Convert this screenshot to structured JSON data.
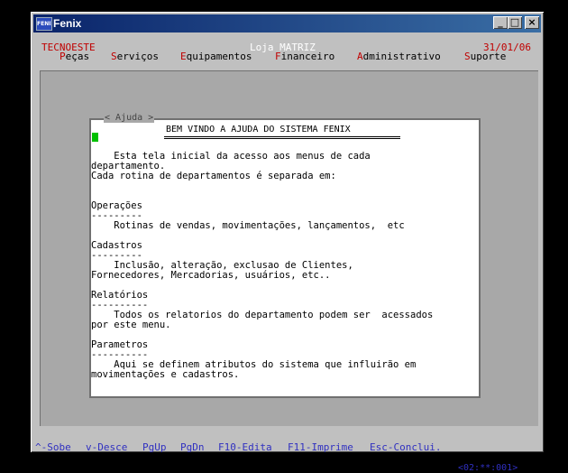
{
  "window": {
    "title": "Fenix",
    "icon_text": "FENIX",
    "buttons": {
      "minimize": "_",
      "maximize": "□",
      "close": "×"
    }
  },
  "header": {
    "company": "TECNOESTE",
    "store": "Loja MATRIZ",
    "date": "31/01/06"
  },
  "menu": [
    {
      "hotkey": "P",
      "rest": "eças"
    },
    {
      "hotkey": "S",
      "rest": "erviços"
    },
    {
      "hotkey": "E",
      "rest": "quipamentos"
    },
    {
      "hotkey": "F",
      "rest": "inanceiro"
    },
    {
      "hotkey": "A",
      "rest": "dministrativo"
    },
    {
      "hotkey": "S",
      "rest": "uporte"
    }
  ],
  "help": {
    "frame_label": "< Ajuda >",
    "title": "BEM VINDO A AJUDA DO SISTEMA FENIX",
    "lines": [
      "    Esta tela inicial da acesso aos menus de cada",
      "departamento.",
      "Cada rotina de departamentos é separada em:",
      "",
      "",
      "Operações",
      "---------",
      "    Rotinas de vendas, movimentações, lançamentos,  etc",
      "",
      "Cadastros",
      "---------",
      "    Inclusão, alteração, exclusao de Clientes,",
      "Fornecedores, Mercadorias, usuários, etc..",
      "",
      "Relatórios",
      "----------",
      "    Todos os relatorios do departamento podem ser  acessados",
      "por este menu.",
      "",
      "Parametros",
      "----------",
      "    Aqui se definem atributos do sistema que influirão em",
      "movimentações e cadastros."
    ]
  },
  "footer": {
    "keys": [
      "^-Sobe",
      "v-Desce",
      "PgUp",
      "PgDn",
      "F10-Edita",
      "F11-Imprime",
      "Esc-Conclui."
    ],
    "status": "<02:**:001>"
  },
  "colors": {
    "accent_red": "#c00000",
    "footer_blue": "#3030c0",
    "cursor_green": "#00c000"
  }
}
